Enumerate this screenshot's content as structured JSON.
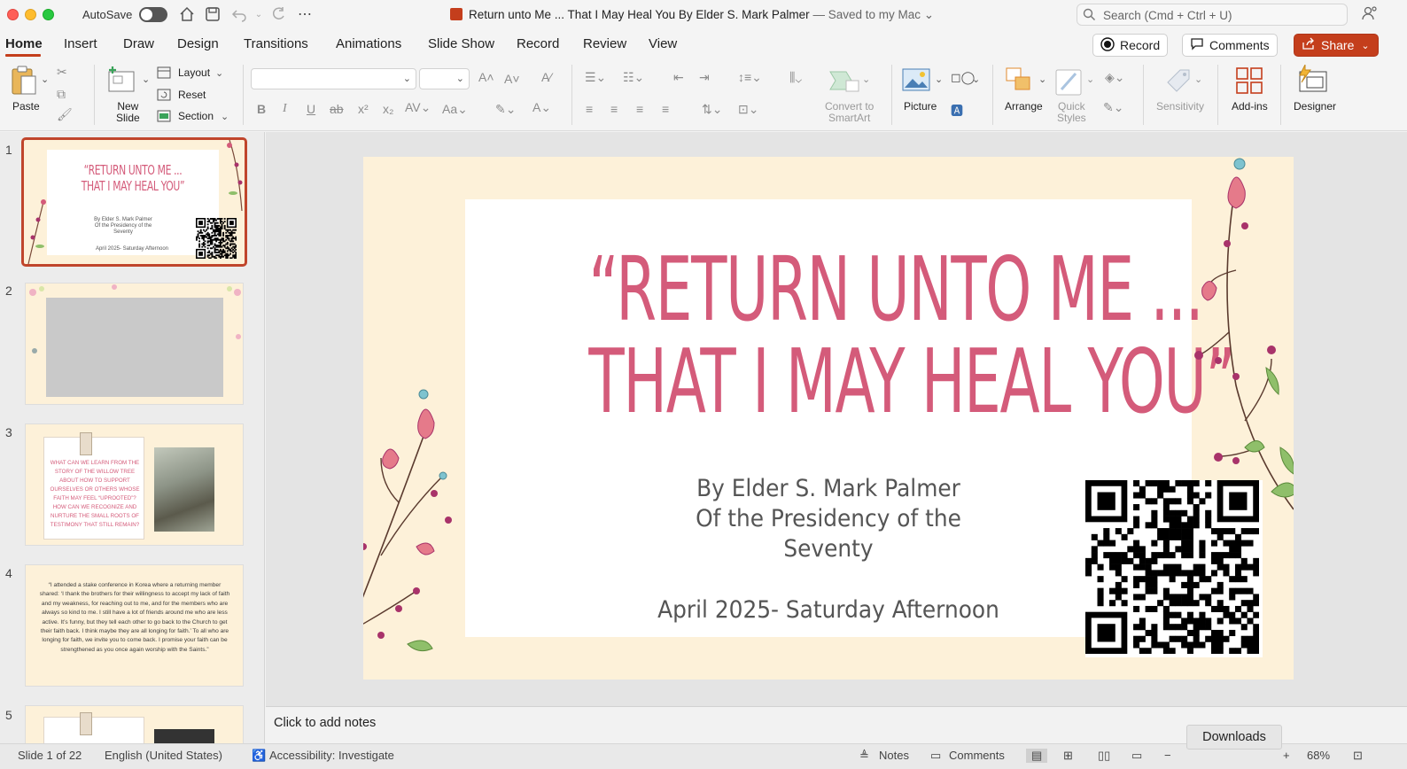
{
  "titlebar": {
    "autosave_label": "AutoSave",
    "doc_title": "Return unto Me ... That I May Heal You By Elder S. Mark Palmer",
    "saved_status": "— Saved to my Mac",
    "search_placeholder": "Search (Cmd + Ctrl + U)"
  },
  "tabs": [
    "Home",
    "Insert",
    "Draw",
    "Design",
    "Transitions",
    "Animations",
    "Slide Show",
    "Record",
    "Review",
    "View"
  ],
  "actions": {
    "record": "Record",
    "comments": "Comments",
    "share": "Share"
  },
  "ribbon": {
    "paste": "Paste",
    "new_slide": [
      "New",
      "Slide"
    ],
    "layout": "Layout",
    "reset": "Reset",
    "section": "Section",
    "convert": [
      "Convert to",
      "SmartArt"
    ],
    "picture": "Picture",
    "arrange": "Arrange",
    "quick_styles": [
      "Quick",
      "Styles"
    ],
    "sensitivity": "Sensitivity",
    "addins": "Add-ins",
    "designer": "Designer"
  },
  "thumbnails": {
    "numbers": [
      "1",
      "2",
      "3",
      "4",
      "5"
    ],
    "t1": {
      "title": [
        "“RETURN UNTO ME ...",
        "THAT I MAY HEAL YOU”"
      ],
      "sub": [
        "By Elder S. Mark Palmer",
        "Of the Presidency of the",
        "Seventy"
      ],
      "date": "April 2025- Saturday Afternoon"
    },
    "t3_text": "WHAT CAN WE LEARN FROM THE STORY OF THE WILLOW TREE ABOUT HOW TO SUPPORT OURSELVES OR OTHERS WHOSE FAITH MAY FEEL “UPROOTED”? HOW CAN WE RECOGNIZE AND NURTURE THE SMALL ROOTS OF TESTIMONY THAT STILL REMAIN?",
    "t4_text": "“I attended a stake conference in Korea where a returning member shared: ‘I thank the brothers for their willingness to accept my lack of faith and my weakness, for reaching out to me, and for the members who are always so kind to me. I still have a lot of friends around me who are less active. It’s funny, but they tell each other to go back to the Church to get their faith back. I think maybe they are all longing for faith.’ To all who are longing for faith, we invite you to come back. I promise your faith can be strengthened as you once again worship with the Saints.”"
  },
  "slide": {
    "title_line1": "“RETURN UNTO ME ...",
    "title_line2": "THAT I MAY HEAL YOU”",
    "author_line1": "By Elder S. Mark Palmer",
    "author_line2": "Of the Presidency of the",
    "author_line3": "Seventy",
    "date": "April 2025- Saturday Afternoon"
  },
  "notes_placeholder": "Click to add notes",
  "status": {
    "slide_count": "Slide 1 of 22",
    "language": "English (United States)",
    "accessibility": "Accessibility: Investigate",
    "notes": "Notes",
    "comments": "Comments",
    "zoom": "68%"
  },
  "downloads_tooltip": "Downloads",
  "colors": {
    "accent": "#c43e1c",
    "title_pink": "#d45b7a",
    "slide_bg": "#fdf1d9"
  }
}
